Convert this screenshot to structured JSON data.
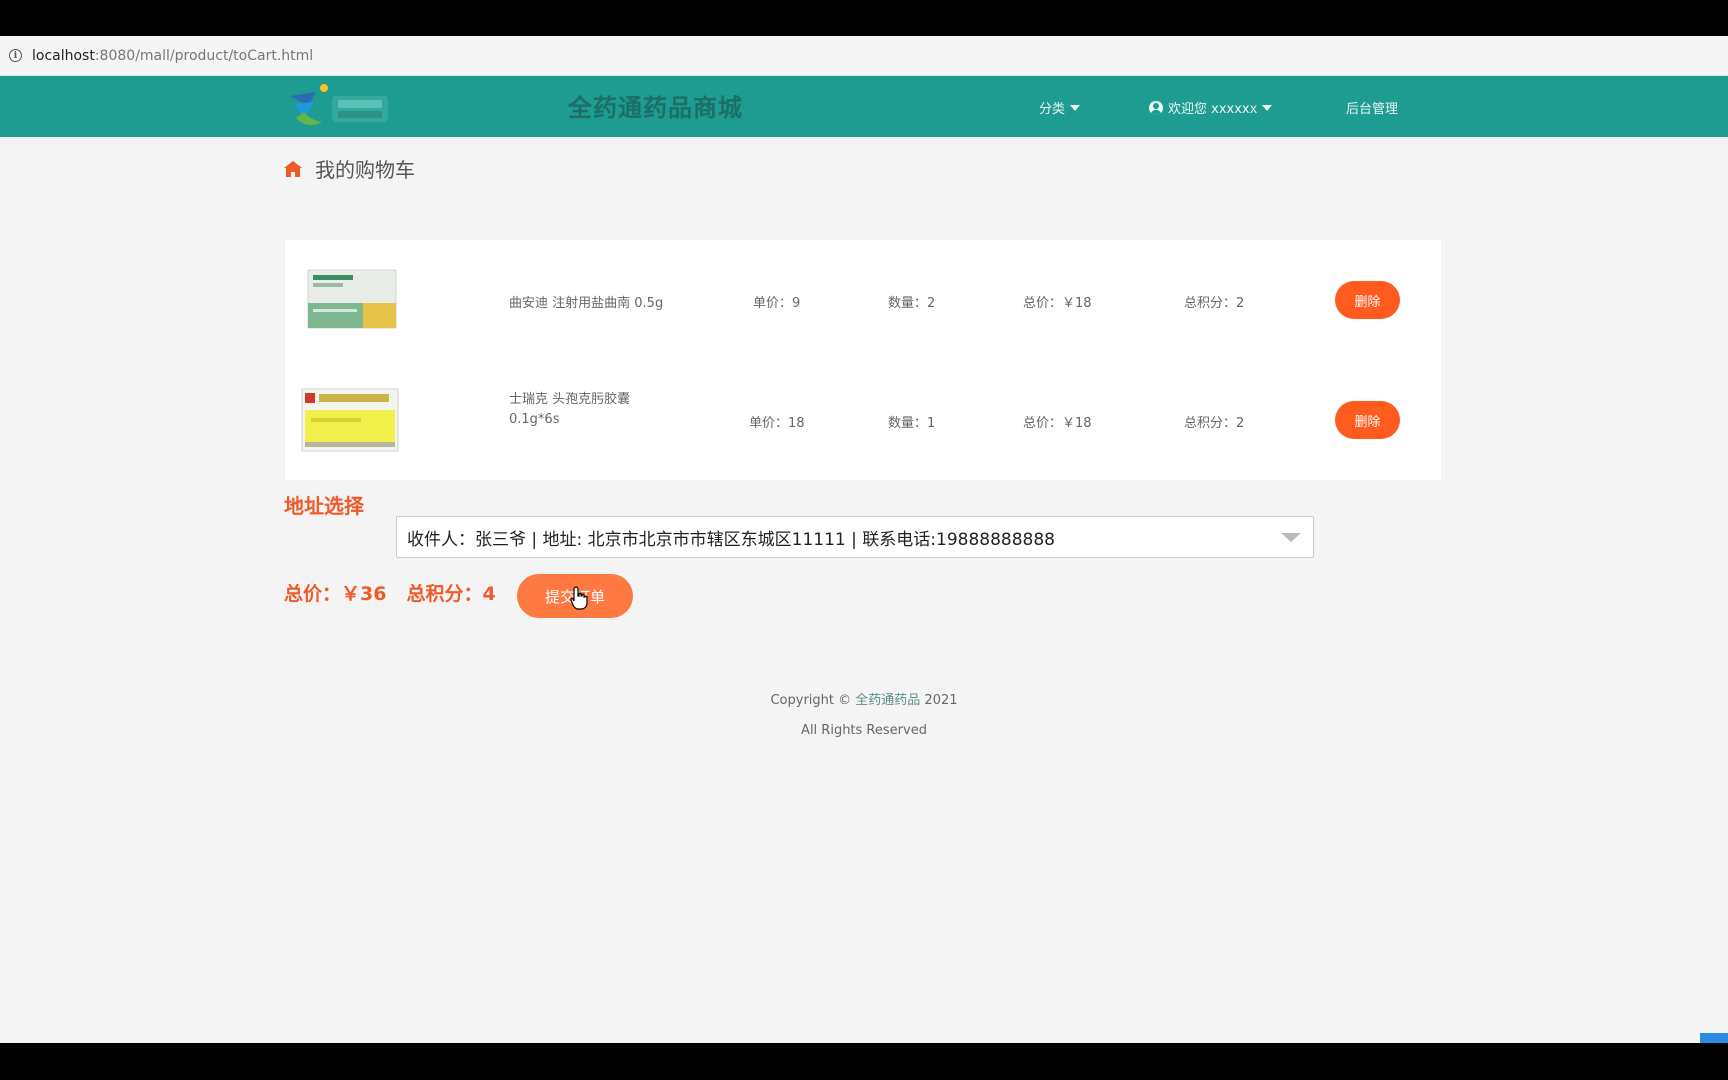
{
  "browser": {
    "url_host": "localhost",
    "url_rest": ":8080/mall/product/toCart.html"
  },
  "navbar": {
    "site_title": "全药通药品商城",
    "category_label": "分类",
    "user_label": "欢迎您 xxxxxx",
    "admin_label": "后台管理"
  },
  "page": {
    "title": "我的购物车"
  },
  "cart": {
    "items": [
      {
        "name_line1": "曲安迪 注射用盐曲南 0.5g",
        "name_line2": "",
        "unit_price": "单价：9",
        "quantity": "数量：2",
        "total": "总价：￥18",
        "points": "总积分：2",
        "delete_label": "删除"
      },
      {
        "name_line1": "士瑞克 头孢克肟胶囊",
        "name_line2": "0.1g*6s",
        "unit_price": "单价：18",
        "quantity": "数量：1",
        "total": "总价：￥18",
        "points": "总积分：2",
        "delete_label": "删除"
      }
    ]
  },
  "address": {
    "label": "地址选择",
    "selected": "收件人：张三爷 | 地址: 北京市北京市市辖区东城区11111 | 联系电话:19888888888"
  },
  "summary": {
    "total": "总价：￥36",
    "points": "总积分：4",
    "submit_label": "提交订单"
  },
  "footer": {
    "copyright_prefix": "Copyright © ",
    "brand": "全药通药品",
    "year": " 2021",
    "rights": "All Rights Reserved"
  },
  "colors": {
    "navbar": "#1e9c91",
    "accent": "#f05a28",
    "delete_button": "#ff5b1f",
    "submit_button": "#ff7a43"
  }
}
